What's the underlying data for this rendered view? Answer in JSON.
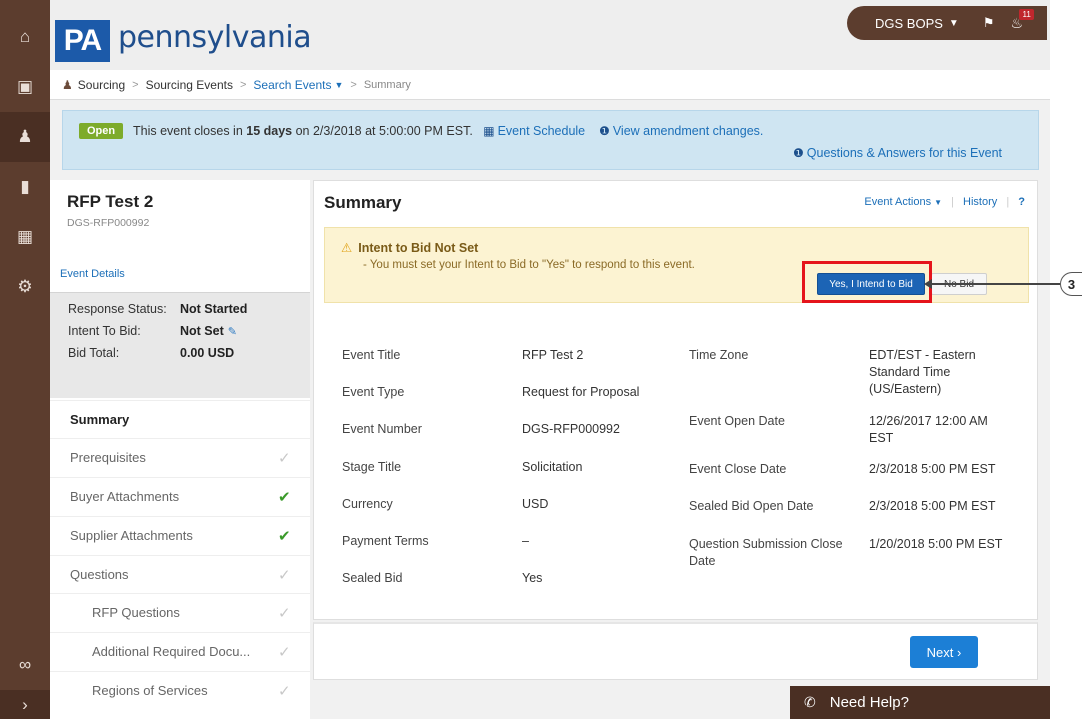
{
  "rail": {
    "icons": [
      "home-icon",
      "book-icon",
      "sourcing-icon",
      "chart-icon",
      "building-icon",
      "gear-icon",
      "binoculars-icon",
      "expand-icon"
    ]
  },
  "header": {
    "logo_abbr": "PA",
    "logo_name": "pennsylvania",
    "user": "DGS BOPS",
    "notification_count": "11"
  },
  "breadcrumb": {
    "items": [
      "Sourcing",
      "Sourcing Events",
      "Search Events",
      "Summary"
    ]
  },
  "banner": {
    "status": "Open",
    "text_before": "This event closes in ",
    "days": "15 days",
    "text_after": " on 2/3/2018 at 5:00:00 PM EST.",
    "schedule_link": "Event Schedule",
    "amendment_link": "View amendment changes.",
    "qa_link": "Questions & Answers for this Event"
  },
  "event": {
    "title": "RFP Test 2",
    "id": "DGS-RFP000992",
    "details_link": "Event Details",
    "response_status_label": "Response Status:",
    "response_status": "Not Started",
    "intent_label": "Intent To Bid:",
    "intent": "Not Set",
    "bid_total_label": "Bid Total:",
    "bid_total": "0.00 USD"
  },
  "nav": [
    {
      "label": "Summary",
      "check": ""
    },
    {
      "label": "Prerequisites",
      "check": "✓"
    },
    {
      "label": "Buyer Attachments",
      "check": "✔"
    },
    {
      "label": "Supplier Attachments",
      "check": "✔"
    },
    {
      "label": "Questions",
      "check": "✓"
    },
    {
      "label": "RFP Questions",
      "check": "✓"
    },
    {
      "label": "Additional Required Docu...",
      "check": "✓"
    },
    {
      "label": "Regions of Services",
      "check": "✓"
    }
  ],
  "summary": {
    "title": "Summary",
    "event_actions": "Event Actions",
    "history": "History",
    "help": "?",
    "warn_title": "Intent to Bid Not Set",
    "warn_msg": "- You must set your Intent to Bid to \"Yes\" to respond to this event.",
    "yes_button": "Yes, I Intend to Bid",
    "no_bid_button": "No Bid",
    "callout_number": "3",
    "fields_left": [
      {
        "label": "Event Title",
        "value": "RFP Test 2"
      },
      {
        "label": "Event Type",
        "value": "Request for Proposal"
      },
      {
        "label": "Event Number",
        "value": "DGS-RFP000992"
      },
      {
        "label": "Stage Title",
        "value": "Solicitation"
      },
      {
        "label": "Currency",
        "value": "USD"
      },
      {
        "label": "Payment Terms",
        "value": "–"
      },
      {
        "label": "Sealed Bid",
        "value": "Yes"
      }
    ],
    "fields_right": [
      {
        "label": "Time Zone",
        "value": "EDT/EST - Eastern Standard Time (US/Eastern)"
      },
      {
        "label": "Event Open Date",
        "value": "12/26/2017 12:00 AM EST"
      },
      {
        "label": "Event Close Date",
        "value": "2/3/2018 5:00 PM EST"
      },
      {
        "label": "Sealed Bid Open Date",
        "value": "2/3/2018 5:00 PM EST"
      },
      {
        "label": "Question Submission Close Date",
        "value": "1/20/2018 5:00 PM EST"
      }
    ],
    "next_button": "Next ›"
  },
  "help": {
    "label": "Need Help?"
  }
}
